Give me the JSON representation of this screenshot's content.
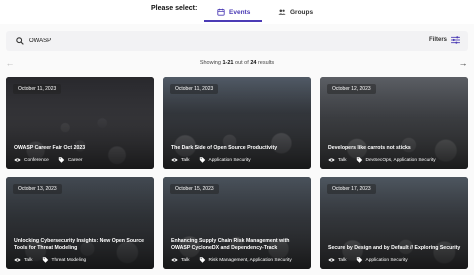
{
  "selector": {
    "label": "Please select:",
    "tabs": [
      {
        "label": "Events",
        "active": true,
        "icon": "calendar-icon"
      },
      {
        "label": "Groups",
        "active": false,
        "icon": "people-icon"
      }
    ]
  },
  "search": {
    "value": "OWASP",
    "filters_label": "Filters"
  },
  "results": {
    "prefix": "Showing ",
    "range": "1-21",
    "middle": " out of ",
    "total": "24",
    "suffix": " results"
  },
  "colors": {
    "accent": "#4b3bb5"
  },
  "cards": [
    {
      "date": "October 11, 2023",
      "title": "OWASP Career Fair Oct 2023",
      "type": "Conference",
      "topic": "Career"
    },
    {
      "date": "October 11, 2023",
      "title": "The Dark Side of Open Source Productivity",
      "type": "Talk",
      "topic": "Application Security"
    },
    {
      "date": "October 12, 2023",
      "title": "Developers like carrots not sticks",
      "type": "Talk",
      "topic": "DevSecOps, Application Security"
    },
    {
      "date": "October 13, 2023",
      "title": "Unlocking Cybersecurity Insights: New Open Source Tools for Threat Modeling",
      "type": "Talk",
      "topic": "Threat Modeling"
    },
    {
      "date": "October 15, 2023",
      "title": "Enhancing Supply Chain Risk Management with OWASP CycloneDX and Dependency-Track",
      "type": "Talk",
      "topic": "Risk Management, Application Security"
    },
    {
      "date": "October 17, 2023",
      "title": "Secure by Design and by Default // Exploring Security",
      "type": "Talk",
      "topic": "Application Security"
    }
  ]
}
